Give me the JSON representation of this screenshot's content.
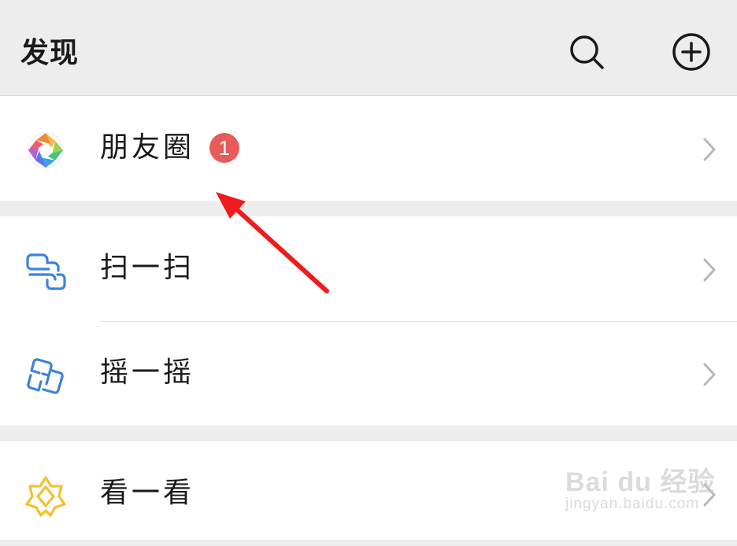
{
  "header": {
    "title": "发现",
    "actions": [
      {
        "icon": "search-icon"
      },
      {
        "icon": "add-circle-icon"
      }
    ]
  },
  "items": [
    {
      "label": "朋友圈",
      "icon": "moments-aperture-icon",
      "badge": "1"
    },
    {
      "label": "扫一扫",
      "icon": "scan-icon"
    },
    {
      "label": "摇一摇",
      "icon": "shake-icon"
    },
    {
      "label": "看一看",
      "icon": "top-stories-icon"
    }
  ],
  "watermark": {
    "main": "Bai du 经验",
    "sub": "jingyan.baidu.com"
  },
  "colors": {
    "background": "#ededed",
    "badge": "#e85b58",
    "annotation_arrow": "#ee1c1c",
    "icon_blue": "#3b82e0",
    "icon_yellow": "#f2c12e"
  }
}
